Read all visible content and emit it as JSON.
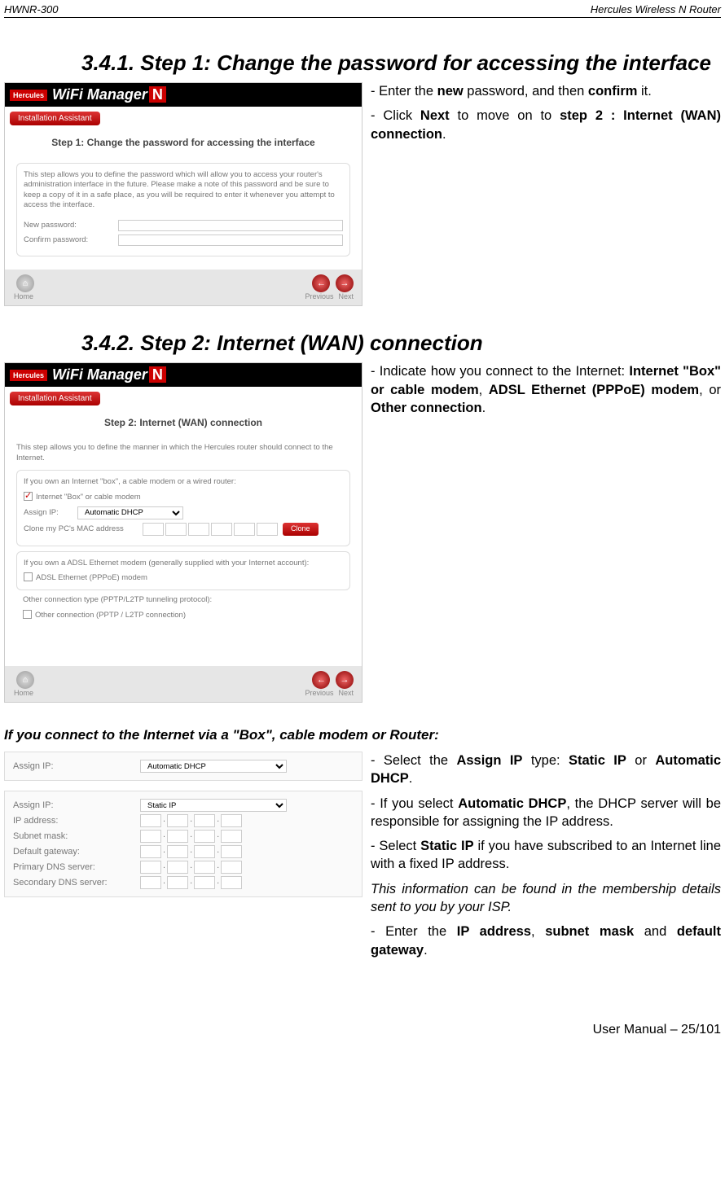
{
  "header": {
    "left": "HWNR-300",
    "right": "Hercules Wireless N Router"
  },
  "section1": {
    "heading": "3.4.1.  Step 1: Change the password for accessing the interface",
    "screenshot": {
      "tab": "Installation Assistant",
      "title": "Step 1: Change the password for accessing the interface",
      "paragraph": "This step allows you to define the password which will allow you to access your router's administration interface in the future. Please make a note of this password and be sure to keep a copy of it in a safe place, as you will be required to enter it whenever you attempt to access the interface.",
      "fields": {
        "new_password": "New password:",
        "confirm_password": "Confirm password:"
      },
      "home": "Home",
      "prev": "Previous",
      "next": "Next"
    },
    "side": {
      "p1_pre": "- Enter the ",
      "p1_b1": "new",
      "p1_mid": " password, and then ",
      "p1_b2": "confirm",
      "p1_end": " it.",
      "p2_pre": "- Click ",
      "p2_b1": "Next",
      "p2_mid": " to move on to ",
      "p2_b2": "step 2 : Internet (WAN) connection",
      "p2_end": "."
    }
  },
  "section2": {
    "heading": "3.4.2. Step 2: Internet (WAN) connection",
    "screenshot": {
      "tab": "Installation Assistant",
      "title": "Step 2: Internet (WAN) connection",
      "paragraph": "This step allows you to define the manner in which the Hercules router should connect to the Internet.",
      "group1": "If you own an Internet \"box\", a cable modem or a wired router:",
      "opt1": "Internet \"Box\" or cable modem",
      "assign_ip": "Assign IP:",
      "assign_ip_value": "Automatic DHCP",
      "clone_mac": "Clone my PC's MAC address",
      "clone": "Clone",
      "group2": "If you own a ADSL Ethernet modem (generally supplied with your Internet account):",
      "opt2": "ADSL Ethernet (PPPoE) modem",
      "group3": "Other connection type (PPTP/L2TP tunneling protocol):",
      "opt3": "Other connection (PPTP / L2TP connection)",
      "home": "Home",
      "prev": "Previous",
      "next": "Next"
    },
    "side": {
      "p1_pre": "- Indicate how you connect to the Internet: ",
      "p1_b1": "Internet \"Box\" or cable modem",
      "p1_s1": ", ",
      "p1_b2": "ADSL Ethernet (PPPoE) modem",
      "p1_s2": ", or ",
      "p1_b3": "Other connection",
      "p1_end": "."
    }
  },
  "section3": {
    "heading": "If you connect to the Internet via a \"Box\", cable modem or Router:",
    "snippet1": {
      "assign_ip": "Assign IP:",
      "value": "Automatic DHCP"
    },
    "snippet2": {
      "assign_ip": "Assign IP:",
      "value": "Static IP",
      "ip_address": "IP address:",
      "subnet_mask": "Subnet mask:",
      "default_gateway": "Default gateway:",
      "primary_dns": "Primary DNS server:",
      "secondary_dns": "Secondary DNS server:"
    },
    "side": {
      "p1_a": "- Select the ",
      "p1_b": "Assign IP",
      "p1_c": " type: ",
      "p1_d": "Static IP",
      "p1_e": " or ",
      "p1_f": "Automatic DHCP",
      "p1_g": ".",
      "p2_a": "- If you select ",
      "p2_b": "Automatic DHCP",
      "p2_c": ", the DHCP server will be responsible for assigning the IP address.",
      "p3_a": "- Select ",
      "p3_b": "Static IP",
      "p3_c": " if you have subscribed to an Internet line with a fixed IP address.",
      "p4": "This information can be found in the membership details sent to you by your ISP.",
      "p5_a": "- Enter the ",
      "p5_b": "IP address",
      "p5_c": ", ",
      "p5_d": "subnet mask",
      "p5_e": " and  ",
      "p5_f": "default gateway",
      "p5_g": "."
    }
  },
  "footer": "User Manual – 25/101",
  "brand": "WiFi Manager",
  "brand_n": "N",
  "logo": "Hercules"
}
